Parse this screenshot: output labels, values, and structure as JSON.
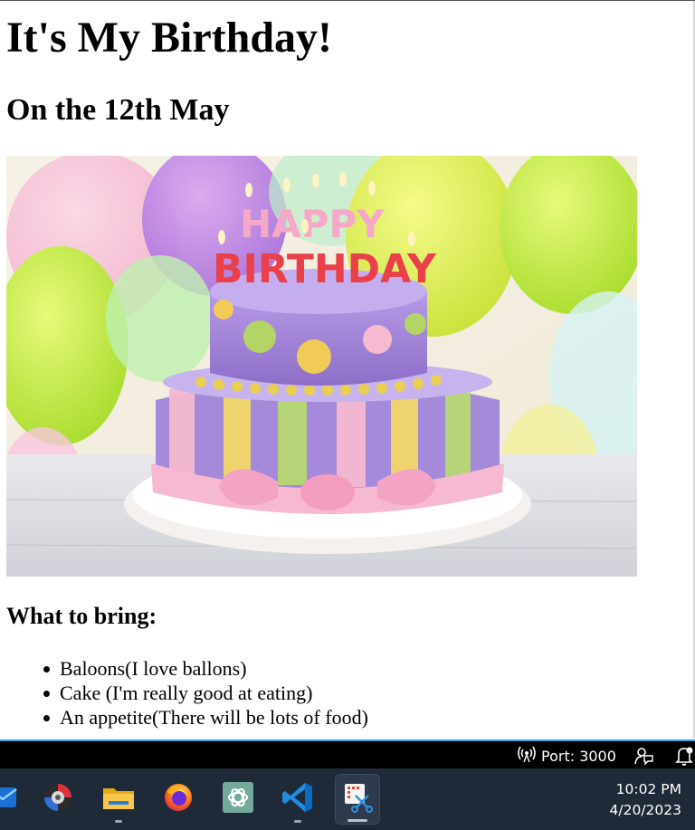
{
  "page": {
    "title": "It's My Birthday!",
    "subtitle": "On the 12th May",
    "image_alt": "Birthday cake",
    "cake_letters_top": "HAPPY",
    "cake_letters_bottom": "BIRTHDAY",
    "bring_heading": "What to bring:",
    "bring_items": [
      "Baloons(I love ballons)",
      "Cake (I'm really good at eating)",
      "An appetite(There will be lots of food)"
    ]
  },
  "statusbar": {
    "port_icon": "broadcast-icon",
    "port_label": "Port: 3000",
    "feedback_icon": "feedback-icon",
    "notification_icon": "bell-icon",
    "background": "#000000",
    "accent": "#3a9fd8"
  },
  "taskbar": {
    "apps": [
      {
        "name": "Mail",
        "icon": "mail-icon"
      },
      {
        "name": "Obsidian-like disc app",
        "icon": "disc-app-icon"
      },
      {
        "name": "File Explorer",
        "icon": "folder-icon"
      },
      {
        "name": "Firefox",
        "icon": "firefox-icon"
      },
      {
        "name": "ChatGPT",
        "icon": "chatgpt-icon"
      },
      {
        "name": "Visual Studio Code",
        "icon": "vscode-icon"
      },
      {
        "name": "Snipping Tool",
        "icon": "snipping-tool-icon"
      }
    ],
    "time": "10:02 PM",
    "date": "4/20/2023",
    "background": "#1f2a38"
  }
}
